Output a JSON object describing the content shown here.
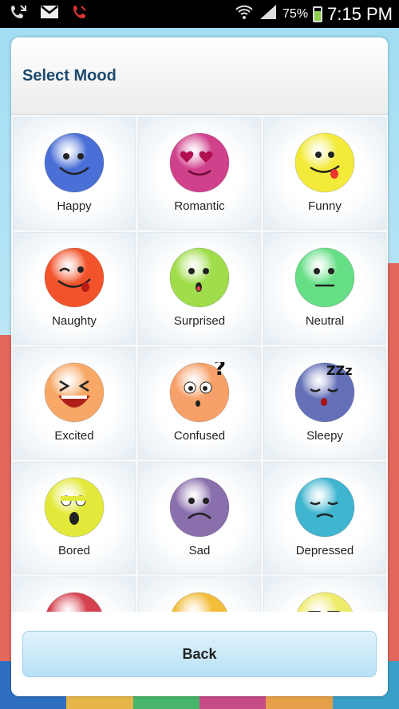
{
  "status_bar": {
    "battery_percent": "75%",
    "time": "7:15 PM",
    "icons": [
      "missed-call-icon",
      "gmail-icon",
      "phone-icon",
      "wifi-icon",
      "signal-icon",
      "battery-icon"
    ]
  },
  "dialog": {
    "title": "Select Mood",
    "back_label": "Back"
  },
  "moods": [
    {
      "label": "Happy",
      "color": "#4a6fd6"
    },
    {
      "label": "Romantic",
      "color": "#d0418c"
    },
    {
      "label": "Funny",
      "color": "#f3ea3a"
    },
    {
      "label": "Naughty",
      "color": "#f2532b"
    },
    {
      "label": "Surprised",
      "color": "#a0dd4b"
    },
    {
      "label": "Neutral",
      "color": "#66de86"
    },
    {
      "label": "Excited",
      "color": "#f7a866"
    },
    {
      "label": "Confused",
      "color": "#f7a069"
    },
    {
      "label": "Sleepy",
      "color": "#6470b8"
    },
    {
      "label": "Bored",
      "color": "#e2e93a"
    },
    {
      "label": "Sad",
      "color": "#8a6fad"
    },
    {
      "label": "Depressed",
      "color": "#3fb5cf"
    },
    {
      "label": "",
      "color": "#d6414f"
    },
    {
      "label": "",
      "color": "#f3bd3a"
    },
    {
      "label": "",
      "color": "#eeea6a"
    }
  ]
}
